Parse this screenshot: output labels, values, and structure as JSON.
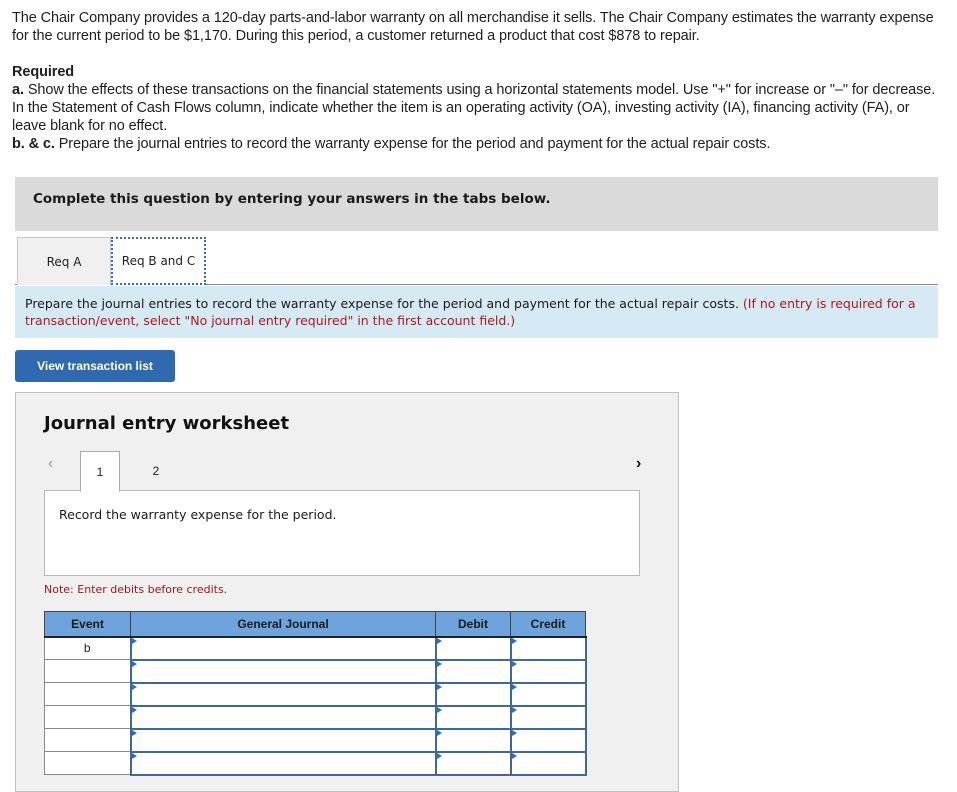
{
  "problem": {
    "intro": "The Chair Company provides a 120-day parts-and-labor warranty on all merchandise it sells. The Chair Company estimates the warranty expense for the current period to be $1,170. During this period, a customer returned a product that cost $878 to repair.",
    "required_heading": "Required",
    "req_a_prefix": "a.",
    "req_a_text": " Show the effects of these transactions on the financial statements using a horizontal statements model. Use \"+\" for increase or \"–\" for decrease. In the Statement of Cash Flows column, indicate whether the item is an operating activity (OA), investing activity (IA), financing activity (FA), or leave blank for no effect.",
    "req_bc_prefix": "b. & c.",
    "req_bc_text": " Prepare the journal entries to record the warranty expense for the period and payment for the actual repair costs."
  },
  "banner": "Complete this question by entering your answers in the tabs below.",
  "tabs": [
    {
      "label": "Req A",
      "active": false
    },
    {
      "label": "Req B and C",
      "active": true
    }
  ],
  "instructions": {
    "main": "Prepare the journal entries to record the warranty expense for the period and payment for the actual repair costs. ",
    "note": "(If no entry is required for a transaction/event, select \"No journal entry required\" in the first account field.)"
  },
  "view_button": "View transaction list",
  "worksheet": {
    "title": "Journal entry worksheet",
    "prev_icon": "‹",
    "next_icon": "›",
    "pages": [
      "1",
      "2"
    ],
    "current_page": "1",
    "description": "Record the warranty expense for the period.",
    "note": "Note: Enter debits before credits.",
    "columns": [
      "Event",
      "General Journal",
      "Debit",
      "Credit"
    ],
    "rows": [
      {
        "event": "b",
        "account": "",
        "debit": "",
        "credit": ""
      },
      {
        "event": "",
        "account": "",
        "debit": "",
        "credit": ""
      },
      {
        "event": "",
        "account": "",
        "debit": "",
        "credit": ""
      },
      {
        "event": "",
        "account": "",
        "debit": "",
        "credit": ""
      },
      {
        "event": "",
        "account": "",
        "debit": "",
        "credit": ""
      },
      {
        "event": "",
        "account": "",
        "debit": "",
        "credit": ""
      }
    ]
  },
  "colors": {
    "button_blue": "#2f6ab0",
    "header_blue": "#6fa3dc",
    "instruction_bg": "#d6eaf6",
    "note_red": "#a01818"
  }
}
